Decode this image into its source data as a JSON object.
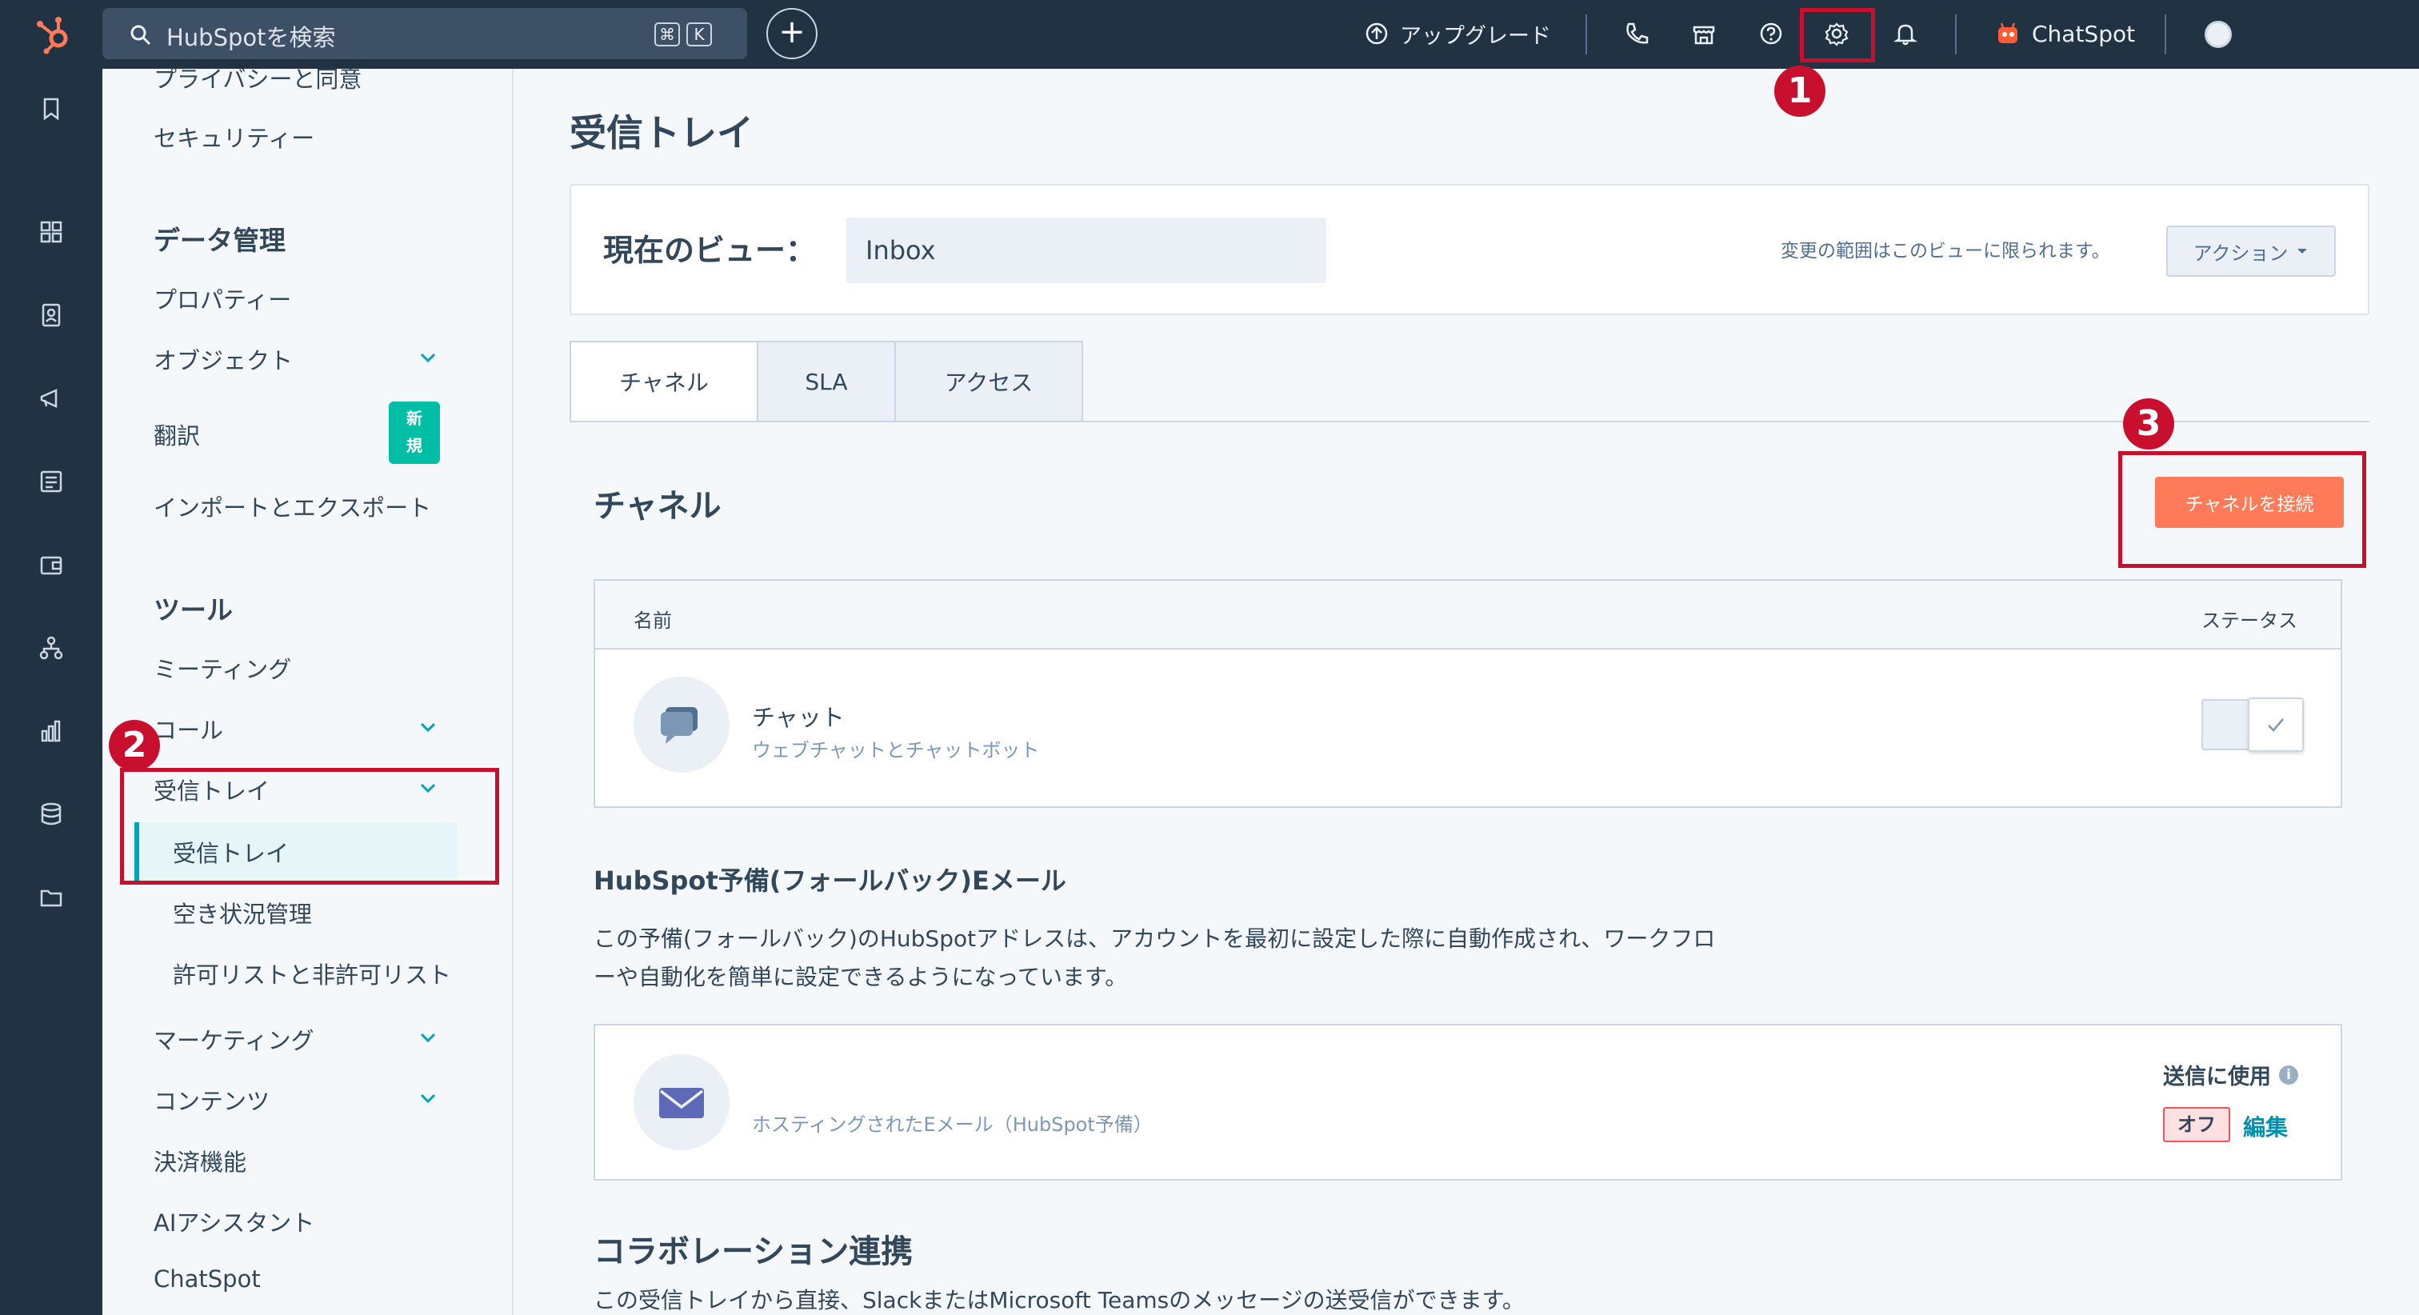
{
  "topbar": {
    "search_placeholder": "HubSpotを検索",
    "shortcut_keys": [
      "⌘",
      "K"
    ],
    "plus_label": "+",
    "upgrade_label": "アップグレード",
    "chatspot_label": "ChatSpot"
  },
  "sidebar": {
    "items_top": [
      "プライバシーと同意",
      "セキュリティー"
    ],
    "data_header": "データ管理",
    "data_items": [
      "プロパティー",
      "オブジェクト",
      "翻訳",
      "インポートとエクスポート"
    ],
    "new_badge": "新規",
    "tools_header": "ツール",
    "tools_items": [
      "ミーティング",
      "コール",
      "受信トレイ"
    ],
    "inbox_sub": [
      "受信トレイ",
      "空き状況管理",
      "許可リストと非許可リスト"
    ],
    "more_items": [
      "マーケティング",
      "コンテンツ",
      "決済機能",
      "AIアシスタント",
      "ChatSpot"
    ]
  },
  "main": {
    "title": "受信トレイ",
    "view_label": "現在のビュー：",
    "view_value": "Inbox",
    "view_note": "変更の範囲はこのビューに限られます。",
    "action_label": "アクション",
    "tabs": [
      "チャネル",
      "SLA",
      "アクセス"
    ],
    "channels_title": "チャネル",
    "connect_button": "チャネルを接続",
    "table": {
      "col_name": "名前",
      "col_status": "ステータス",
      "rows": [
        {
          "name": "チャット",
          "desc": "ウェブチャットとチャットボット"
        }
      ]
    },
    "fallback_title": "HubSpot予備(フォールバック)Eメール",
    "fallback_para_1": "この予備(フォールバック)のHubSpotアドレスは、アカウントを最初に設定した際に自動作成され、ワークフロ",
    "fallback_para_2": "ーや自動化を簡単に設定できるようになっています。",
    "email_desc": "ホスティングされたEメール（HubSpot予備）",
    "send_label": "送信に使用",
    "off_label": "オフ",
    "edit_label": "編集",
    "collab_title": "コラボレーション連携",
    "collab_para": "この受信トレイから直接、SlackまたはMicrosoft Teamsのメッセージの送受信ができます。"
  },
  "annotations": {
    "markers": [
      "1",
      "2",
      "3"
    ]
  },
  "colors": {
    "topbar": "#213343",
    "accent_orange": "#ff7a59",
    "highlight_red": "#c8102e",
    "teal": "#00a4bd",
    "new_badge": "#00bda5"
  }
}
